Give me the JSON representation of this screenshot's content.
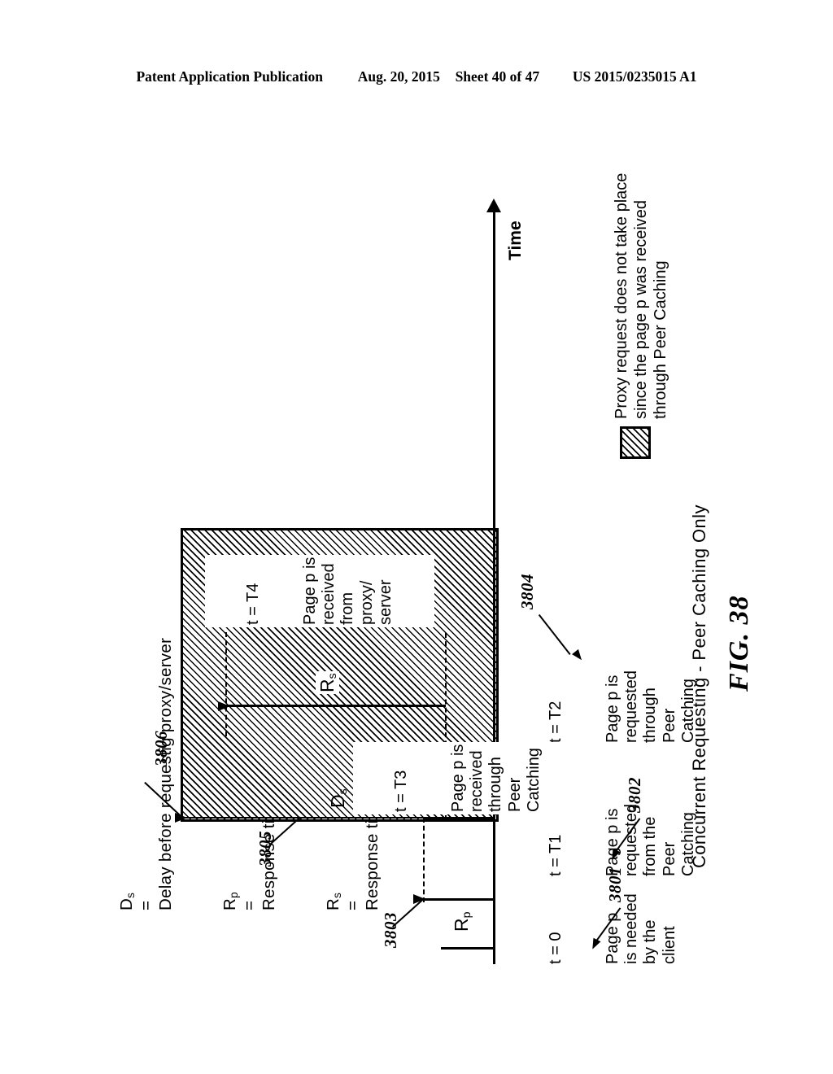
{
  "header": {
    "publication": "Patent Application Publication",
    "date": "Aug. 20, 2015",
    "sheet": "Sheet 40 of 47",
    "number": "US 2015/0235015 A1"
  },
  "definitions": [
    {
      "symbol": "D",
      "subscript": "s",
      "equals": "=",
      "text": "Delay before requestig proxy/server"
    },
    {
      "symbol": "R",
      "subscript": "p",
      "equals": "=",
      "text": "Response time through Peer Caching"
    },
    {
      "symbol": "R",
      "subscript": "s",
      "equals": "=",
      "text": "Response time of the proxy/server"
    }
  ],
  "axis": {
    "label": "Time"
  },
  "measures": {
    "rp": {
      "symbol": "R",
      "subscript": "p"
    },
    "ds": {
      "symbol": "D",
      "subscript": "s"
    },
    "rs": {
      "symbol": "R",
      "subscript": "s"
    }
  },
  "events": [
    {
      "time": "t = 0",
      "lines": "Page p\nis needed\nby the\nclient"
    },
    {
      "time": "t = T1",
      "lines": "Page p is\nrequested\nfrom the\nPeer\nCatching"
    },
    {
      "time": "t = T2",
      "lines": "Page p is\nrequested\nthrough\nPeer\nCatching"
    },
    {
      "time": "t = T3",
      "lines": "Page p is\nreceived\nthrough\nPeer\nCatching"
    },
    {
      "time": "t = T4",
      "lines": "Page p is\nreceived\nfrom\nproxy/\nserver"
    }
  ],
  "refs": {
    "r3801": "3801",
    "r3802": "3802",
    "r3803": "3803",
    "r3804": "3804",
    "r3805": "3805",
    "r3806": "3806"
  },
  "key": {
    "text": "Proxy request does not take place since\nthe page p was received through\nPeer Caching"
  },
  "caption": "Concurrent Requesting  -  Peer Caching Only",
  "fig_number": "FIG. 38"
}
